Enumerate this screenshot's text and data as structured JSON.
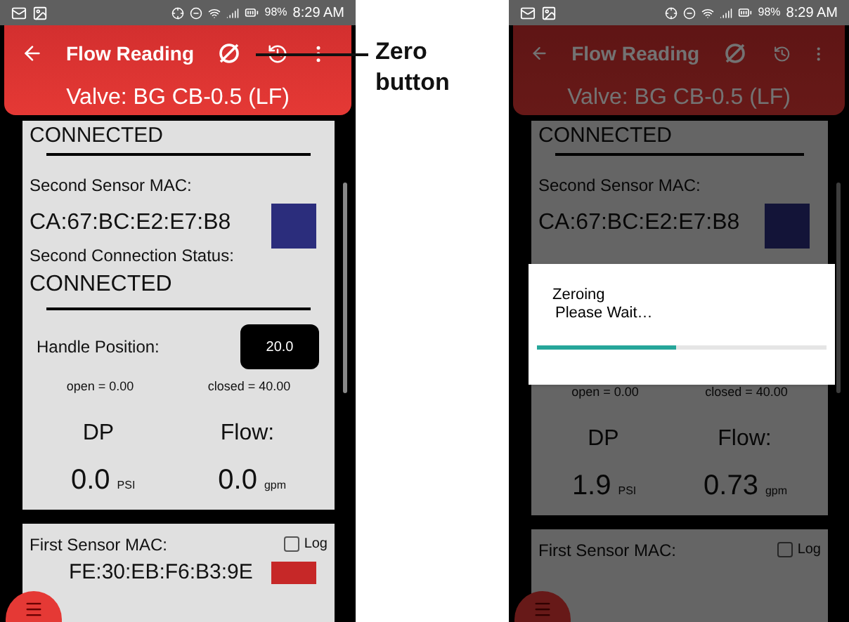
{
  "left_screen": {
    "status_bar": {
      "battery": "98%",
      "time": "8:29 AM"
    },
    "header": {
      "title": "Flow Reading",
      "subtitle": "Valve: BG CB-0.5 (LF)"
    },
    "card": {
      "top_status": "CONNECTED",
      "second_mac_label": "Second Sensor MAC:",
      "second_mac": "CA:67:BC:E2:E7:B8",
      "second_swatch": {
        "color": "#2b2d7c"
      },
      "second_status_label": "Second Connection Status:",
      "second_status": "CONNECTED",
      "handle_label": "Handle Position:",
      "handle_value": "20.0",
      "open": "open = 0.00",
      "closed": "closed = 40.00",
      "dp_label": "DP",
      "dp_value": "0.0",
      "dp_unit": "PSI",
      "flow_label": "Flow:",
      "flow_value": "0.0",
      "flow_unit": "gpm"
    },
    "first_card": {
      "label": "First Sensor MAC:",
      "log_label": "Log",
      "log_checked": false,
      "mac": "FE:30:EB:F6:B3:9E",
      "color": "#c62828"
    }
  },
  "annotation": {
    "text": "Zero button"
  },
  "right_screen": {
    "status_bar": {
      "battery": "98%",
      "time": "8:29 AM"
    },
    "header": {
      "title": "Flow Reading",
      "subtitle": "Valve: BG CB-0.5 (LF)"
    },
    "card": {
      "top_status": "CONNECTED",
      "second_mac_label": "Second Sensor MAC:",
      "second_mac": "CA:67:BC:E2:E7:B8",
      "second_swatch": {
        "color": "#131438"
      },
      "open": "open = 0.00",
      "closed": "closed = 40.00",
      "dp_label": "DP",
      "dp_value": "1.9",
      "dp_unit": "PSI",
      "flow_label": "Flow:",
      "flow_value": "0.73",
      "flow_unit": "gpm"
    },
    "first_card": {
      "label": "First Sensor MAC:",
      "log_label": "Log",
      "log_checked": false
    },
    "dialog": {
      "title": "Zeroing",
      "message": "Please Wait…",
      "level": 0.48
    }
  }
}
